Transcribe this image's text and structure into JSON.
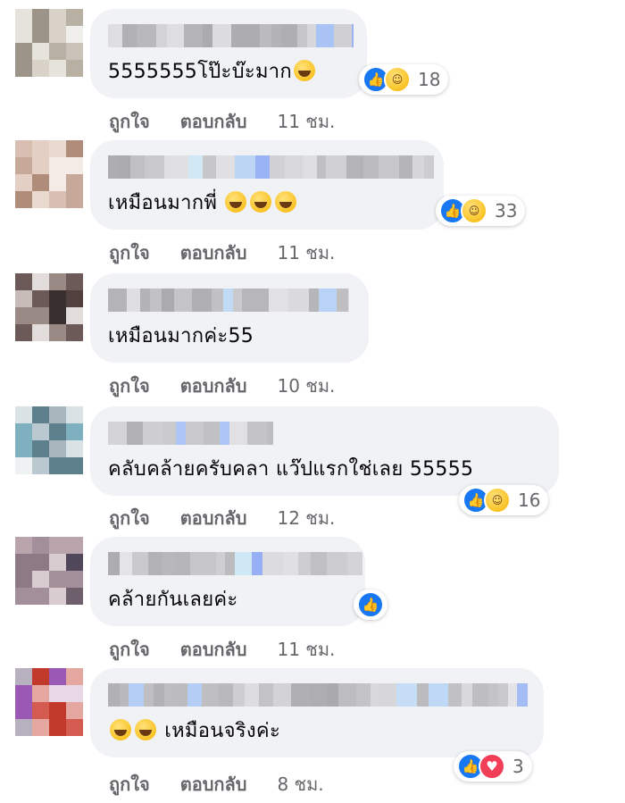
{
  "comments": [
    {
      "text": "5555555โป๊ะบ๊ะมาก",
      "emoji_after": [
        "grinning-squint-face"
      ],
      "emoji_before": [],
      "reactions": [
        "like",
        "haha"
      ],
      "reaction_count": "18",
      "like_label": "ถูกใจ",
      "reply_label": "ตอบกลับ",
      "time": "11 ชม."
    },
    {
      "text": "เหมือนมากพี่",
      "emoji_after": [
        "rolling-laughing-face",
        "rolling-laughing-face",
        "rolling-laughing-face"
      ],
      "emoji_before": [],
      "reactions": [
        "like",
        "haha"
      ],
      "reaction_count": "33",
      "like_label": "ถูกใจ",
      "reply_label": "ตอบกลับ",
      "time": "11 ชม."
    },
    {
      "text": "เหมือนมากค่ะ55",
      "emoji_after": [],
      "emoji_before": [],
      "reactions": [],
      "reaction_count": "",
      "like_label": "ถูกใจ",
      "reply_label": "ตอบกลับ",
      "time": "10 ชม."
    },
    {
      "text": "คลับคล้ายครับคลา แว๊ปแรกใช่เลย 55555",
      "emoji_after": [],
      "emoji_before": [],
      "reactions": [
        "like",
        "haha"
      ],
      "reaction_count": "16",
      "like_label": "ถูกใจ",
      "reply_label": "ตอบกลับ",
      "time": "12 ชม."
    },
    {
      "text": "คล้ายกันเลยค่ะ",
      "emoji_after": [],
      "emoji_before": [],
      "reactions": [
        "like"
      ],
      "reaction_count": "",
      "like_label": "ถูกใจ",
      "reply_label": "ตอบกลับ",
      "time": "11 ชม."
    },
    {
      "text": "เหมือนจริงค่ะ",
      "emoji_after": [],
      "emoji_before": [
        "grinning-face",
        "grinning-face"
      ],
      "reactions": [
        "like",
        "love"
      ],
      "reaction_count": "3",
      "like_label": "ถูกใจ",
      "reply_label": "ตอบกลับ",
      "time": "8 ชม."
    }
  ],
  "colors": {
    "bubble": "#f0f2f5",
    "meta_text": "#65676b",
    "like": "#1877f2",
    "haha": "#f7b500",
    "love": "#f33e58"
  }
}
